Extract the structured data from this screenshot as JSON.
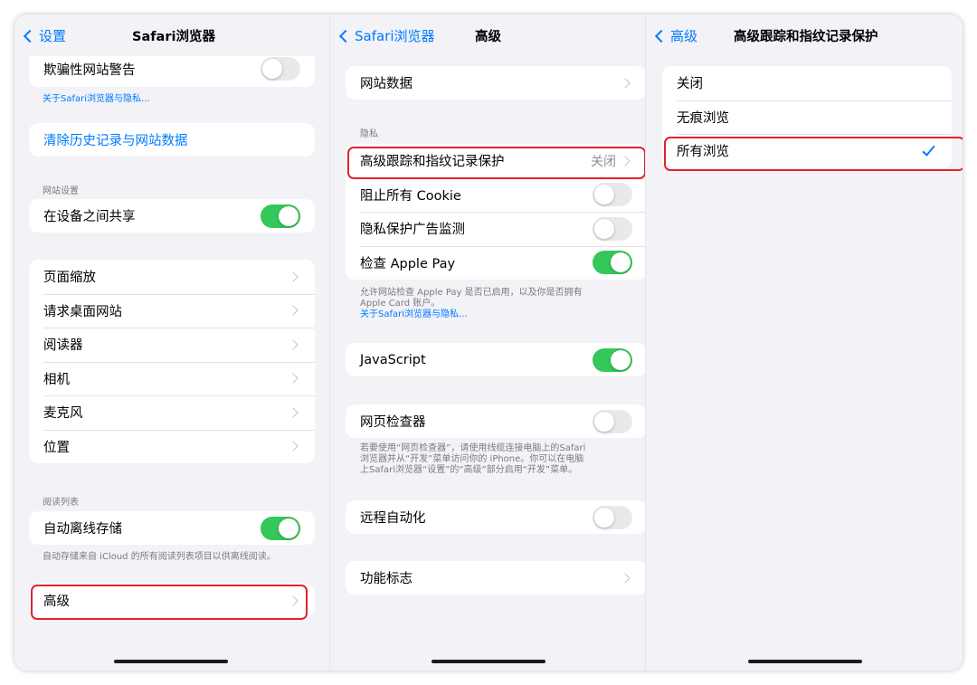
{
  "panel1": {
    "back_label": "设置",
    "title": "Safari浏览器",
    "fraud_warning": "欺骗性网站警告",
    "privacy_link": "关于Safari浏览器与隐私...",
    "clear_history": "清除历史记录与网站数据",
    "site_settings_header": "网站设置",
    "share_across_devices": "在设备之间共享",
    "items": [
      "页面缩放",
      "请求桌面网站",
      "阅读器",
      "相机",
      "麦克风",
      "位置"
    ],
    "reading_list_header": "阅读列表",
    "auto_offline": "自动离线存储",
    "auto_offline_note": "自动存储来自 iCloud 的所有阅读列表项目以供离线阅读。",
    "advanced": "高级"
  },
  "panel2": {
    "back_label": "Safari浏览器",
    "title": "高级",
    "website_data": "网站数据",
    "privacy_header": "隐私",
    "tracking_protection": "高级跟踪和指纹记录保护",
    "tracking_value": "关闭",
    "block_cookies": "阻止所有 Cookie",
    "privacy_ad": "隐私保护广告监测",
    "check_apple_pay": "检查 Apple Pay",
    "apple_pay_note_1": "允许网站检查 Apple Pay 是否已启用，以及你是否拥有",
    "apple_pay_note_2": "Apple Card 账户。",
    "privacy_link": "关于Safari浏览器与隐私...",
    "javascript": "JavaScript",
    "web_inspector": "网页检查器",
    "inspector_note_1": "若要使用“网页检查器”，请使用线缆连接电脑上的Safari",
    "inspector_note_2": "浏览器并从“开发”菜单访问你的 iPhone。你可以在电脑",
    "inspector_note_3": "上Safari浏览器“设置”的“高级”部分启用“开发”菜单。",
    "remote_automation": "远程自动化",
    "feature_flags": "功能标志"
  },
  "panel3": {
    "back_label": "高级",
    "title": "高级跟踪和指纹记录保护",
    "options": [
      "关闭",
      "无痕浏览",
      "所有浏览"
    ],
    "selected_index": 2
  },
  "toggles": {
    "fraud_warning": false,
    "share_across_devices": true,
    "auto_offline": true,
    "block_cookies": false,
    "privacy_ad": false,
    "check_apple_pay": true,
    "javascript": true,
    "web_inspector": false,
    "remote_automation": false
  },
  "colors": {
    "accent": "#007aff",
    "toggle_on": "#34c759",
    "highlight": "#e1232c",
    "background": "#f2f2f7"
  }
}
